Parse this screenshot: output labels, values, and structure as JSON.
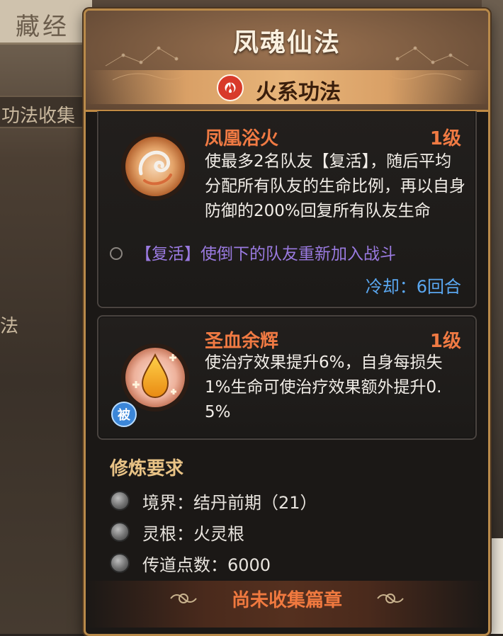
{
  "background": {
    "tab_label": "藏经",
    "side_label": "功法收集",
    "side_label_2": "法"
  },
  "dialog": {
    "title": "凤魂仙法",
    "element": {
      "label": "火系功法",
      "icon": "fire-icon",
      "color": "#d83a2a"
    },
    "skills": [
      {
        "name": "凤凰浴火",
        "level": "1级",
        "icon": "phoenix-icon",
        "description": "使最多2名队友【复活】，随后平均分配所有队友的生命比例，再以自身防御的200%回复所有队友生命",
        "note": "【复活】使倒下的队友重新加入战斗",
        "cooldown": "冷却：6回合"
      },
      {
        "name": "圣血余辉",
        "level": "1级",
        "icon": "blood-drop-icon",
        "badge": "被",
        "description": "使治疗效果提升6%，自身每损失1%生命可使治疗效果额外提升0.5%"
      }
    ],
    "requirements": {
      "title": "修炼要求",
      "items": [
        {
          "text": "境界：结丹前期（21）"
        },
        {
          "text": "灵根：火灵根"
        },
        {
          "text": "传道点数：6000"
        }
      ]
    },
    "footer_label": "尚未收集篇章"
  },
  "colors": {
    "accent": "#f07a43",
    "gold": "#e9c386",
    "note": "#9a7ae0",
    "cooldown": "#5aa7f0"
  }
}
